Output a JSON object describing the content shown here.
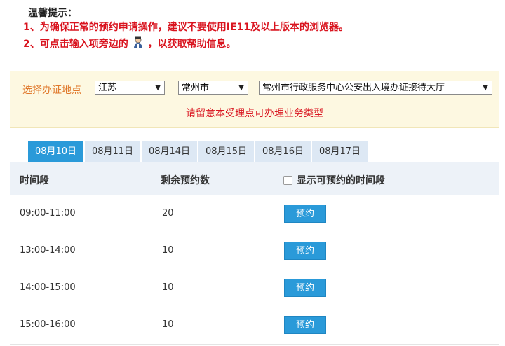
{
  "tips": {
    "title": "温馨提示：",
    "line1": "1、为确保正常的预约申请操作，建议不要使用IE11及以上版本的浏览器。",
    "line2_before": "2、可点击输入项旁边的",
    "line2_after": "，以获取帮助信息。",
    "help_icon": "help-person-icon"
  },
  "selector": {
    "label": "选择办证地点",
    "province": "江苏",
    "city": "常州市",
    "office": "常州市行政服务中心公安出入境办证接待大厅",
    "note": "请留意本受理点可办理业务类型"
  },
  "tabs": [
    "08月10日",
    "08月11日",
    "08月14日",
    "08月15日",
    "08月16日",
    "08月17日"
  ],
  "active_tab": 0,
  "table": {
    "headers": {
      "time": "时间段",
      "remaining": "剩余预约数",
      "show_available": "显示可预约的时间段"
    },
    "rows": [
      {
        "time": "09:00-11:00",
        "remaining": "20",
        "action": "预约"
      },
      {
        "time": "13:00-14:00",
        "remaining": "10",
        "action": "预约"
      },
      {
        "time": "14:00-15:00",
        "remaining": "10",
        "action": "预约"
      },
      {
        "time": "15:00-16:00",
        "remaining": "10",
        "action": "预约"
      }
    ]
  },
  "colors": {
    "accent": "#2a9ad9",
    "warning_red": "#d9141f",
    "label_orange": "#e0782b",
    "selector_bg": "#fdf8e1"
  }
}
